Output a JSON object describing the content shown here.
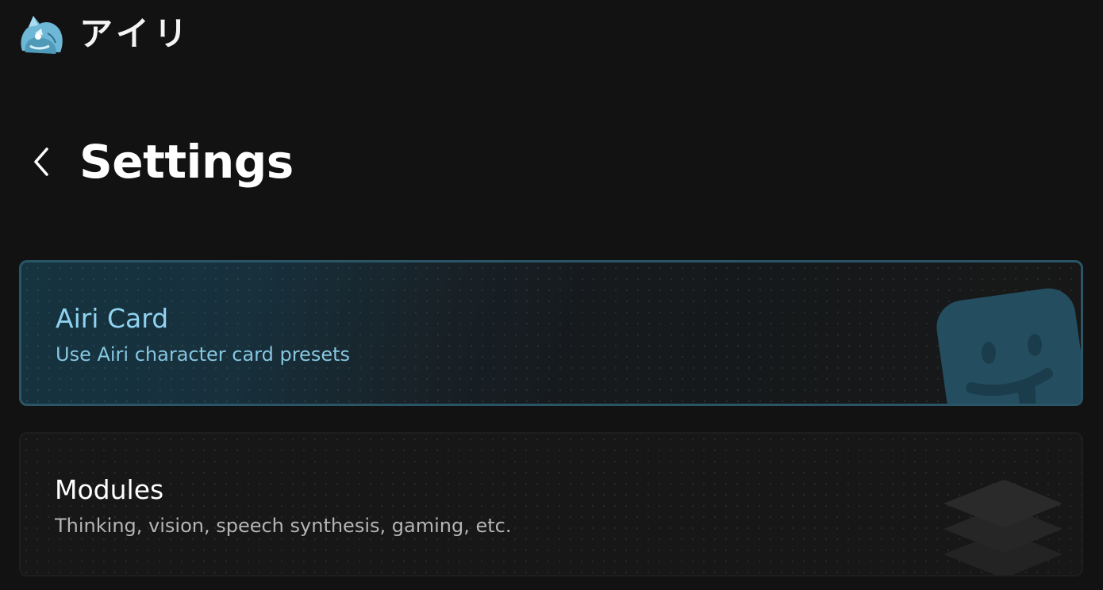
{
  "app": {
    "name": "アイリ",
    "logo_icon": "airi-character-logo-icon"
  },
  "header": {
    "back_icon": "chevron-left-icon",
    "title": "Settings"
  },
  "cards": [
    {
      "id": "airi-card",
      "title": "Airi Card",
      "description": "Use Airi character card presets",
      "icon": "smiley-card-icon",
      "accent": "#8fd3f0",
      "active": true
    },
    {
      "id": "modules",
      "title": "Modules",
      "description": "Thinking, vision, speech synthesis, gaming, etc.",
      "icon": "layers-icon",
      "accent": "#ffffff",
      "active": false
    }
  ],
  "colors": {
    "background": "#121212",
    "active_border": "#2a5566",
    "card_background": "#171717"
  }
}
